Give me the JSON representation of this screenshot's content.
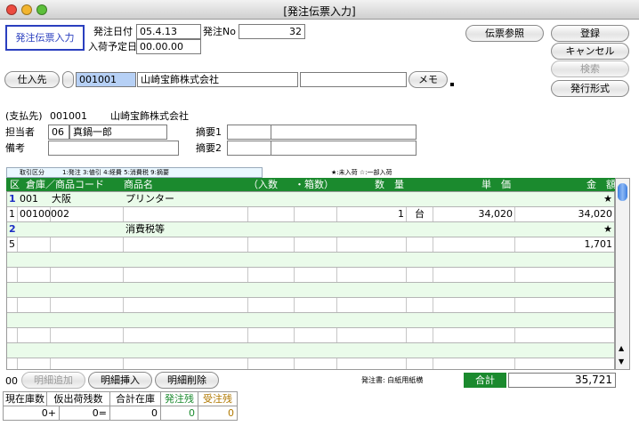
{
  "window": {
    "title": "[発注伝票入力]"
  },
  "header": {
    "mode_badge": "発注伝票入力",
    "order_date_label": "発注日付",
    "order_date_value": "05.4.13",
    "order_no_label": "発注No",
    "order_no_value": "32",
    "arrival_date_label": "入荷予定日",
    "arrival_date_value": "00.00.00"
  },
  "buttons": {
    "slip_ref": "伝票参照",
    "register": "登録",
    "cancel": "キャンセル",
    "search": "検索",
    "issue_format": "発行形式",
    "supplier": "仕入先",
    "memo": "メモ",
    "add_detail": "明細追加",
    "insert_detail": "明細挿入",
    "delete_detail": "明細削除"
  },
  "supplier": {
    "code": "001001",
    "name": "山崎宝飾株式会社",
    "payee_label": "(支払先)",
    "payee_code": "001001",
    "payee_name": "山崎宝飾株式会社"
  },
  "staff": {
    "label": "担当者",
    "code": "06",
    "name": "真鍋一郎",
    "note_label": "備考",
    "summary1_label": "摘要1",
    "summary2_label": "摘要2"
  },
  "legend": {
    "trade_label": "取引区分",
    "trade_text": "1:発注 3:値引 4:経費 5:消費税 9:摘要",
    "star_note": "★:未入荷 ☆:一部入荷"
  },
  "grid": {
    "headers": {
      "kubun": "区",
      "warehouse": "倉庫／商品コード",
      "item": "商品名",
      "qty_in": "（入数",
      "boxes": "・箱数）",
      "quantity": "数　量",
      "unit_price": "単　価",
      "amount": "金　額"
    },
    "rows": [
      {
        "kubun": "1",
        "code": "001",
        "warehouse": "大阪",
        "item": "プリンター",
        "qty": "",
        "unit": "",
        "price": "",
        "amount": "",
        "star": "★"
      },
      {
        "kubun": "1",
        "code": "00100002",
        "warehouse": "",
        "item": "",
        "qty": "1",
        "unit": "台",
        "price": "34,020",
        "amount": "34,020",
        "star": ""
      },
      {
        "kubun": "2",
        "code": "",
        "warehouse": "",
        "item": "消費税等",
        "qty": "",
        "unit": "",
        "price": "",
        "amount": "",
        "star": "★"
      },
      {
        "kubun": "5",
        "code": "",
        "warehouse": "",
        "item": "",
        "qty": "",
        "unit": "",
        "price": "",
        "amount": "1,701",
        "star": ""
      },
      {
        "kubun": "",
        "code": "",
        "warehouse": "",
        "item": "",
        "qty": "",
        "unit": "",
        "price": "",
        "amount": "",
        "star": ""
      },
      {
        "kubun": "",
        "code": "",
        "warehouse": "",
        "item": "",
        "qty": "",
        "unit": "",
        "price": "",
        "amount": "",
        "star": ""
      },
      {
        "kubun": "",
        "code": "",
        "warehouse": "",
        "item": "",
        "qty": "",
        "unit": "",
        "price": "",
        "amount": "",
        "star": ""
      },
      {
        "kubun": "",
        "code": "",
        "warehouse": "",
        "item": "",
        "qty": "",
        "unit": "",
        "price": "",
        "amount": "",
        "star": ""
      },
      {
        "kubun": "",
        "code": "",
        "warehouse": "",
        "item": "",
        "qty": "",
        "unit": "",
        "price": "",
        "amount": "",
        "star": ""
      },
      {
        "kubun": "",
        "code": "",
        "warehouse": "",
        "item": "",
        "qty": "",
        "unit": "",
        "price": "",
        "amount": "",
        "star": ""
      },
      {
        "kubun": "",
        "code": "",
        "warehouse": "",
        "item": "",
        "qty": "",
        "unit": "",
        "price": "",
        "amount": "",
        "star": ""
      },
      {
        "kubun": "",
        "code": "",
        "warehouse": "",
        "item": "",
        "qty": "",
        "unit": "",
        "price": "",
        "amount": "",
        "star": ""
      }
    ]
  },
  "footer": {
    "row_index": "00",
    "print_note": "発注書: 白紙用紙横",
    "total_label": "合計",
    "total_value": "35,721"
  },
  "summary": {
    "stock_label": "現在庫数",
    "pending_label": "仮出荷残数",
    "total_stock_label": "合計在庫",
    "order_remain_label": "発注残",
    "recv_remain_label": "受注残",
    "stock_value": "0+",
    "pending_value": "0=",
    "total_stock_value": "0",
    "order_remain_value": "0",
    "recv_remain_value": "0"
  },
  "colors": {
    "grid_header": "#1b8a2e",
    "green_row": "#eafbea",
    "total_label_bg": "#1b8a2e",
    "order_remain_text": "#1b8a2e",
    "recv_remain_text": "#b07800"
  }
}
